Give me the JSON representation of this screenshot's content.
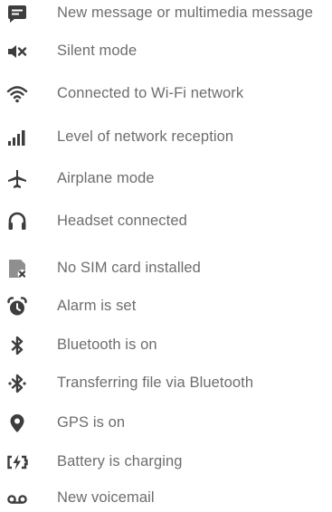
{
  "icon_color": "#3d3d3d",
  "text_color": "#6d6d6d",
  "items": [
    {
      "icon": "message-icon",
      "label": "New message or multimedia message"
    },
    {
      "icon": "silent-mode-icon",
      "label": "Silent mode"
    },
    {
      "icon": "wifi-icon",
      "label": "Connected to Wi-Fi network"
    },
    {
      "icon": "signal-strength-icon",
      "label": "Level of network reception"
    },
    {
      "icon": "airplane-icon",
      "label": "Airplane mode"
    },
    {
      "icon": "headset-icon",
      "label": "Headset connected"
    },
    {
      "icon": "no-sim-icon",
      "label": "No SIM card installed"
    },
    {
      "icon": "alarm-clock-icon",
      "label": "Alarm is set"
    },
    {
      "icon": "bluetooth-icon",
      "label": "Bluetooth is on"
    },
    {
      "icon": "bluetooth-transfer-icon",
      "label": "Transferring file via Bluetooth"
    },
    {
      "icon": "location-pin-icon",
      "label": "GPS is on"
    },
    {
      "icon": "battery-charging-icon",
      "label": "Battery is charging"
    },
    {
      "icon": "voicemail-icon",
      "label": "New voicemail"
    }
  ]
}
